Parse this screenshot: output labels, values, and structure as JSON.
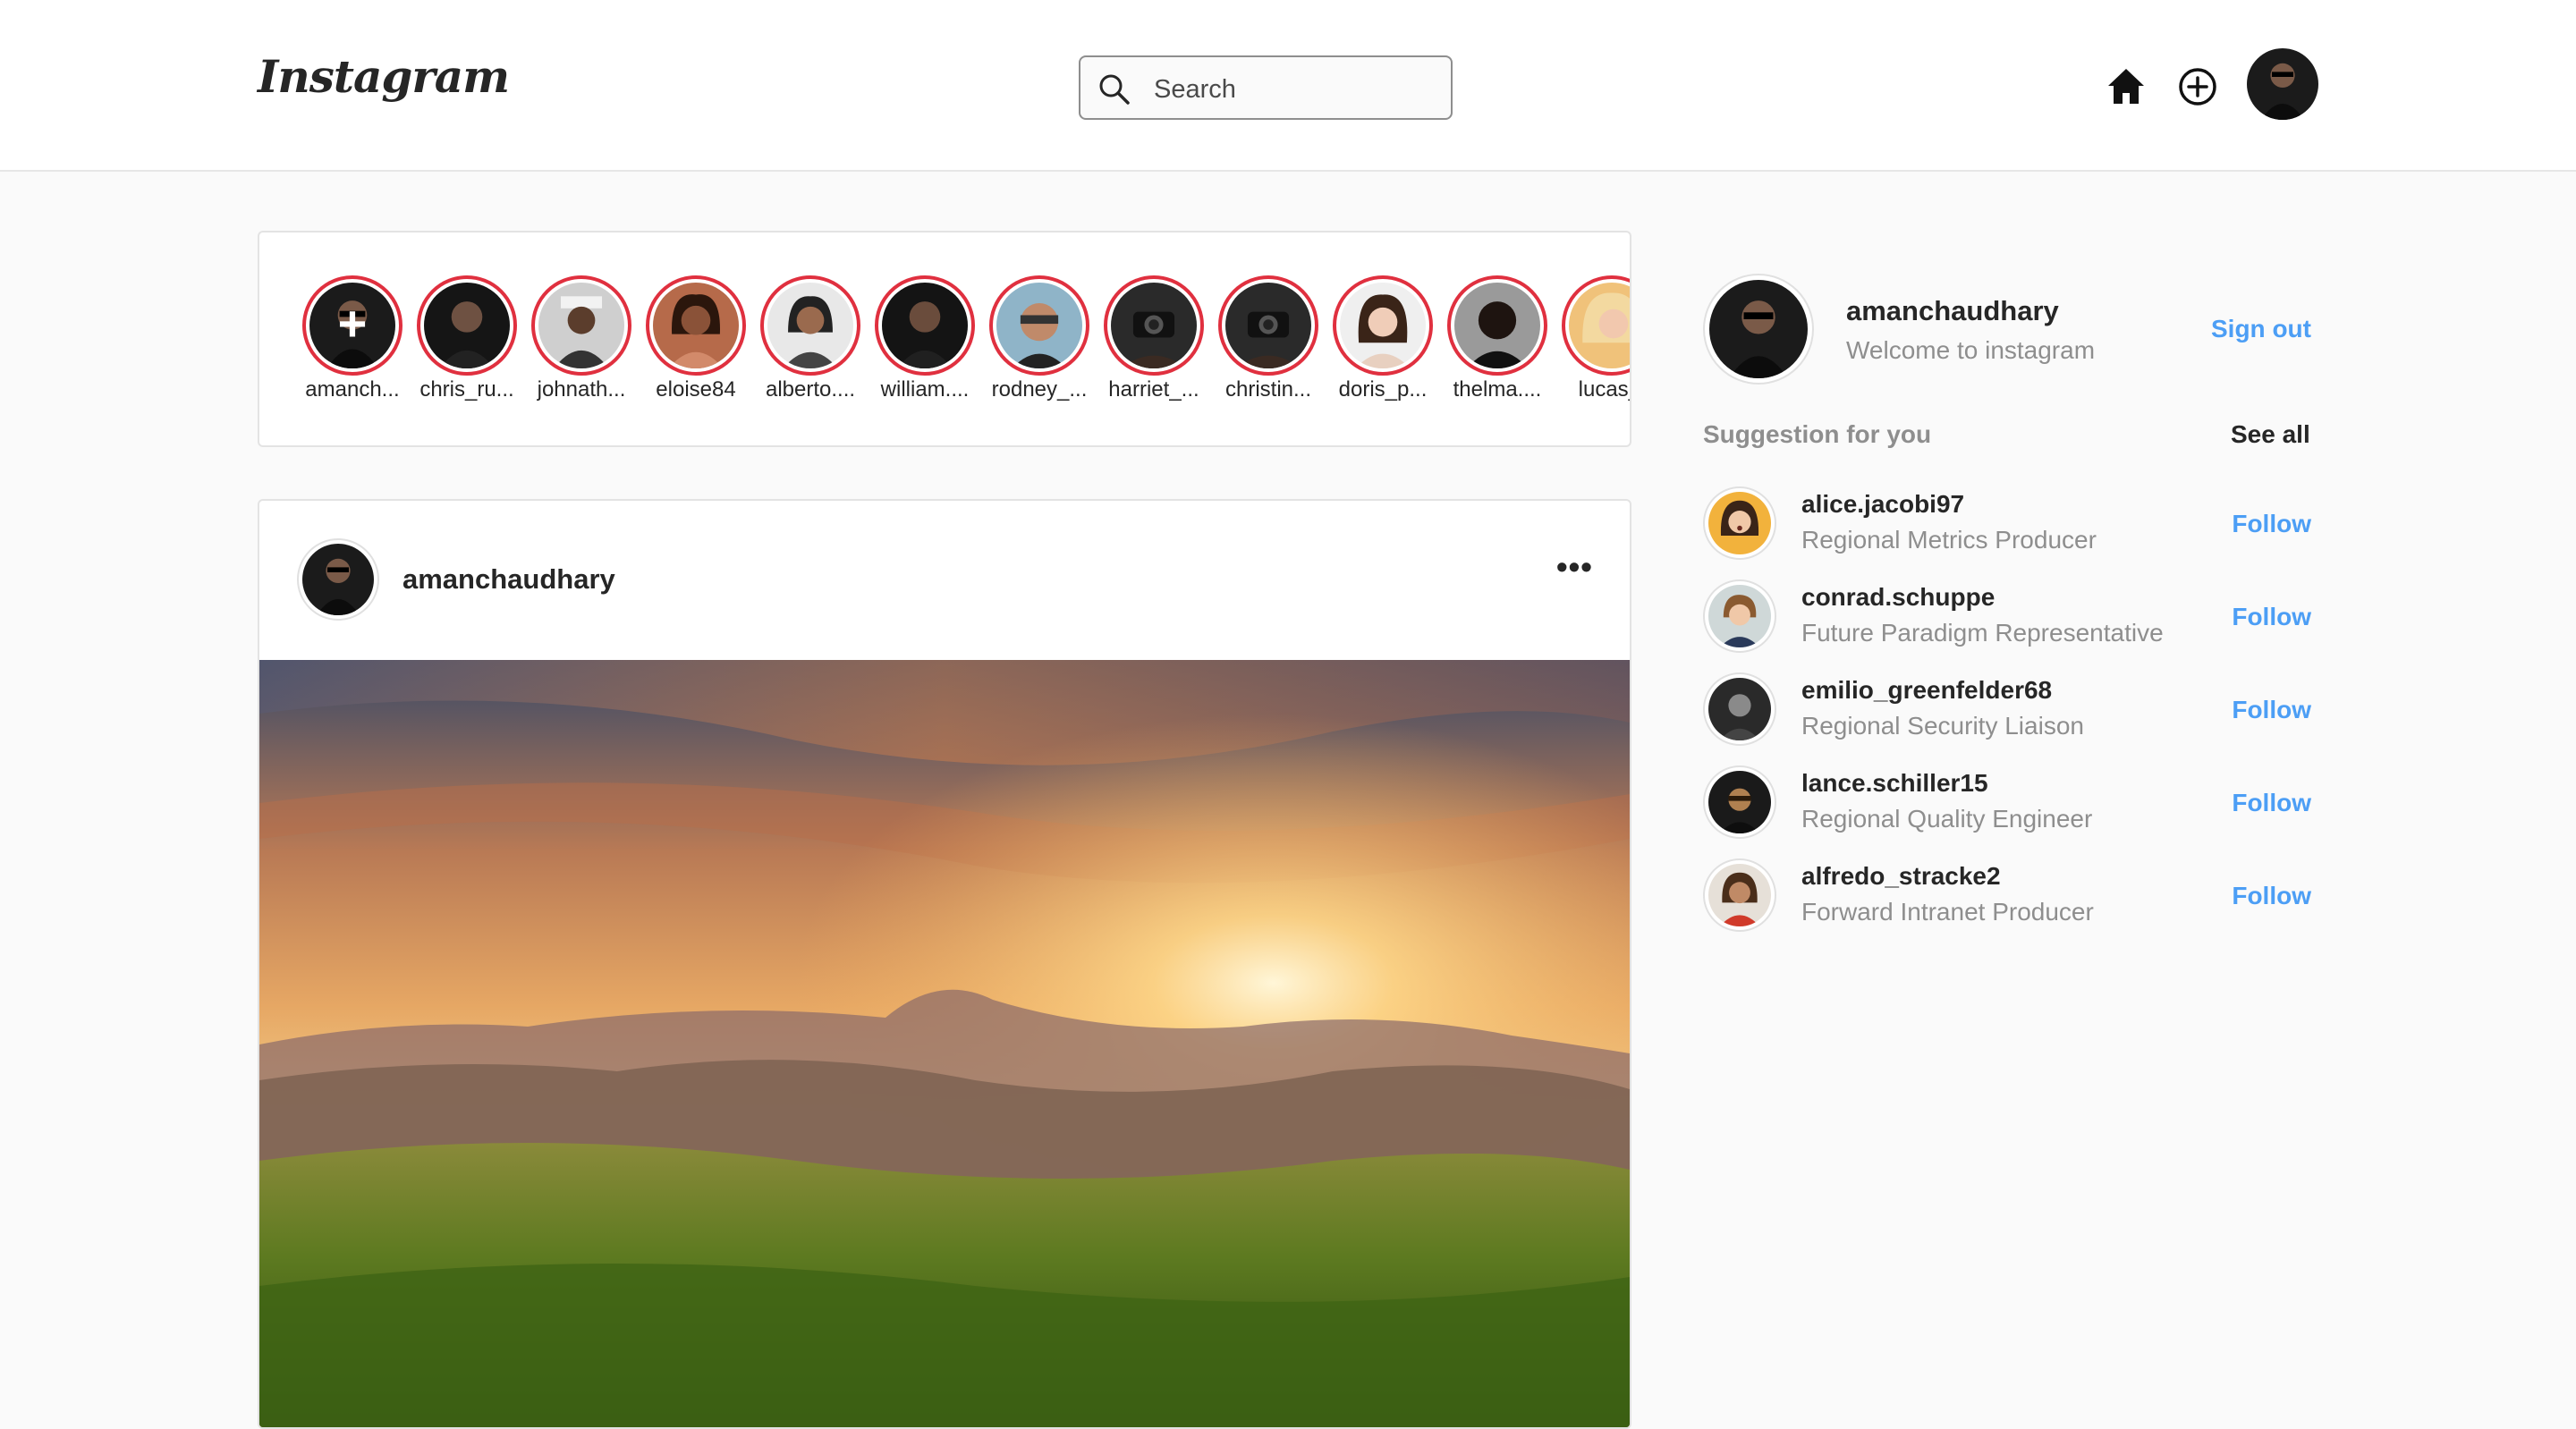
{
  "header": {
    "logo": "Instagram",
    "search_placeholder": "Search"
  },
  "stories": [
    {
      "username": "amanch...",
      "add": true
    },
    {
      "username": "chris_ru..."
    },
    {
      "username": "johnath..."
    },
    {
      "username": "eloise84"
    },
    {
      "username": "alberto...."
    },
    {
      "username": "william...."
    },
    {
      "username": "rodney_..."
    },
    {
      "username": "harriet_..."
    },
    {
      "username": "christin..."
    },
    {
      "username": "doris_p..."
    },
    {
      "username": "thelma...."
    },
    {
      "username": "lucas_l"
    }
  ],
  "post": {
    "username": "amanchaudhary",
    "more": "•••"
  },
  "profile": {
    "username": "amanchaudhary",
    "subtitle": "Welcome to instagram",
    "sign_out": "Sign out"
  },
  "suggestions": {
    "title": "Suggestion for you",
    "see_all": "See all",
    "items": [
      {
        "username": "alice.jacobi97",
        "role": "Regional Metrics Producer",
        "action": "Follow"
      },
      {
        "username": "conrad.schuppe",
        "role": "Future Paradigm Representative",
        "action": "Follow"
      },
      {
        "username": "emilio_greenfelder68",
        "role": "Regional Security Liaison",
        "action": "Follow"
      },
      {
        "username": "lance.schiller15",
        "role": "Regional Quality Engineer",
        "action": "Follow"
      },
      {
        "username": "alfredo_stracke2",
        "role": "Forward Intranet Producer",
        "action": "Follow"
      }
    ]
  },
  "colors": {
    "story_ring": "#e0303f",
    "link_blue": "#4c9ef5",
    "muted": "#8e8e8e"
  },
  "icons": [
    "search-icon",
    "home-icon",
    "add-post-icon",
    "more-options-icon"
  ]
}
